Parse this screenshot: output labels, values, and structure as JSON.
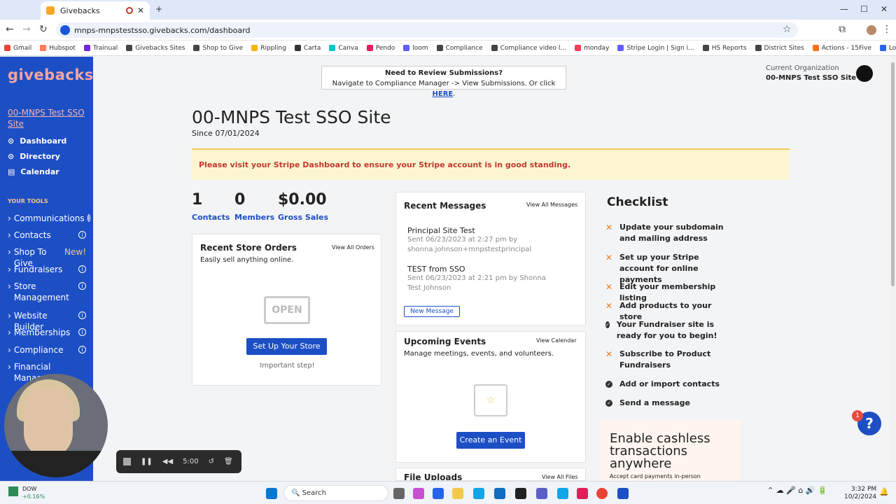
{
  "browser": {
    "tab_title": "Givebacks",
    "url": "mnps-mnpstestsso.givebacks.com/dashboard",
    "bookmarks": [
      "Gmail",
      "Hubspot",
      "Trainual",
      "Givebacks Sites",
      "Shop to Give",
      "Rippling",
      "Carta",
      "Canva",
      "Pendo",
      "loom",
      "Compliance",
      "Compliance video l...",
      "monday",
      "Stripe Login | Sign i...",
      "HS Reports",
      "District Sites",
      "Actions - 15Five",
      "Login | GovSpend"
    ]
  },
  "sidebar": {
    "logo": "givebacks",
    "site_link": "00-MNPS Test SSO Site",
    "nav": [
      {
        "label": "Dashboard",
        "icon": "dashboard-icon"
      },
      {
        "label": "Directory",
        "icon": "location-icon"
      },
      {
        "label": "Calendar",
        "icon": "calendar-icon"
      }
    ],
    "tools_heading": "YOUR TOOLS",
    "tools": [
      {
        "label": "Communications",
        "badge": ""
      },
      {
        "label": "Contacts",
        "badge": ""
      },
      {
        "label": "Shop To Give",
        "badge": "New!"
      },
      {
        "label": "Fundraisers",
        "badge": ""
      },
      {
        "label": "Store Management",
        "badge": ""
      },
      {
        "label": "Website Builder",
        "badge": ""
      },
      {
        "label": "Memberships",
        "badge": ""
      },
      {
        "label": "Compliance",
        "badge": ""
      },
      {
        "label": "Financial Manag...",
        "badge": ""
      }
    ]
  },
  "notice": {
    "title": "Need to Review Submissions?",
    "text": "Navigate to Compliance Manager -> View Submissions.  Or click",
    "link": "HERE",
    "end": "."
  },
  "org": {
    "label": "Current Organization",
    "name": "00-MNPS Test SSO Site"
  },
  "page": {
    "title": "00-MNPS Test SSO Site",
    "since": "Since 07/01/2024"
  },
  "alert": "Please visit your Stripe Dashboard to ensure your Stripe account is in good standing.",
  "stats": [
    {
      "value": "1",
      "label": "Contacts"
    },
    {
      "value": "0",
      "label": "Members"
    },
    {
      "value": "$0.00",
      "label": "Gross Sales"
    }
  ],
  "store_orders": {
    "title": "Recent Store Orders",
    "view_all": "View All Orders",
    "subtitle": "Easily sell anything online.",
    "sign_text": "OPEN",
    "button": "Set Up Your Store",
    "hint": "Important step!"
  },
  "messages": {
    "title": "Recent Messages",
    "view_all": "View All Messages",
    "items": [
      {
        "subject": "Principal Site Test",
        "meta": "Sent 06/23/2023 at 2:27 pm by shonna.johnson+mnpstestprincipal"
      },
      {
        "subject": "TEST from SSO",
        "meta": "Sent 06/23/2023 at 2:21 pm by Shonna Test Johnson"
      }
    ],
    "new_button": "New Message"
  },
  "events": {
    "title": "Upcoming Events",
    "view_all": "View Calendar",
    "subtitle": "Manage meetings, events, and volunteers.",
    "button": "Create an Event"
  },
  "uploads": {
    "title": "File Uploads",
    "view_all": "View All Files"
  },
  "checklist": {
    "title": "Checklist",
    "items": [
      {
        "text": "Update your subdomain and mailing address",
        "done": false
      },
      {
        "text": "Set up your Stripe account for online payments",
        "done": false
      },
      {
        "text": "Edit your membership listing",
        "done": false
      },
      {
        "text": "Add products to your store",
        "done": false
      },
      {
        "text": "Your Fundraiser site is ready for you to begin!",
        "done": true
      },
      {
        "text": "Subscribe to Product Fundraisers",
        "done": false
      },
      {
        "text": "Add or import contacts",
        "done": true
      },
      {
        "text": "Send a message",
        "done": true
      }
    ]
  },
  "promo": {
    "headline": "Enable cashless transactions anywhere",
    "sub": "Accept card payments in-person"
  },
  "help": {
    "label": "?",
    "badge": "1"
  },
  "recorder": {
    "time": "5:00"
  },
  "taskbar": {
    "stock_name": "DOW",
    "stock_change": "+0.16%",
    "search": "Search",
    "time": "3:32 PM",
    "date": "10/2/2024"
  },
  "colors": {
    "brand_blue": "#1d4fc4",
    "alert_red": "#c0392b",
    "alert_bg": "#fdf5d2",
    "warning_orange": "#e67e22"
  }
}
